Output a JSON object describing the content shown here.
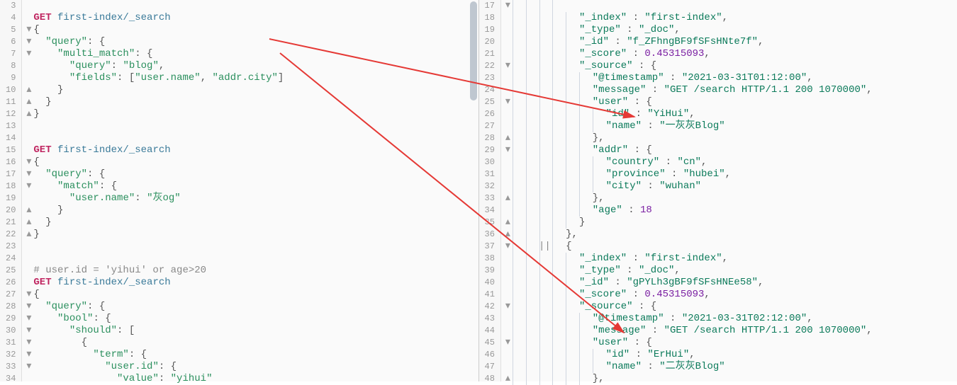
{
  "left": {
    "lines": [
      {
        "n": 3,
        "fold": "",
        "content": [
          {
            "t": " ",
            "c": ""
          }
        ]
      },
      {
        "n": 4,
        "fold": "",
        "content": [
          {
            "t": "GET ",
            "c": "tok-kw"
          },
          {
            "t": "first-index/_search",
            "c": "tok-path"
          }
        ]
      },
      {
        "n": 5,
        "fold": "open",
        "content": [
          {
            "t": "{",
            "c": "tok-punc"
          }
        ]
      },
      {
        "n": 6,
        "fold": "open",
        "content": [
          {
            "t": "  ",
            "c": ""
          },
          {
            "t": "\"query\"",
            "c": "tok-key"
          },
          {
            "t": ": {",
            "c": "tok-punc"
          }
        ]
      },
      {
        "n": 7,
        "fold": "open",
        "content": [
          {
            "t": "    ",
            "c": ""
          },
          {
            "t": "\"multi_match\"",
            "c": "tok-key"
          },
          {
            "t": ": {",
            "c": "tok-punc"
          }
        ]
      },
      {
        "n": 8,
        "fold": "",
        "content": [
          {
            "t": "      ",
            "c": ""
          },
          {
            "t": "\"query\"",
            "c": "tok-key"
          },
          {
            "t": ": ",
            "c": "tok-punc"
          },
          {
            "t": "\"blog\"",
            "c": "tok-str"
          },
          {
            "t": ",",
            "c": "tok-punc"
          }
        ]
      },
      {
        "n": 9,
        "fold": "",
        "content": [
          {
            "t": "      ",
            "c": ""
          },
          {
            "t": "\"fields\"",
            "c": "tok-key"
          },
          {
            "t": ": [",
            "c": "tok-punc"
          },
          {
            "t": "\"user.name\"",
            "c": "tok-str"
          },
          {
            "t": ", ",
            "c": "tok-punc"
          },
          {
            "t": "\"addr.city\"",
            "c": "tok-str"
          },
          {
            "t": "]",
            "c": "tok-punc"
          }
        ]
      },
      {
        "n": 10,
        "fold": "close",
        "content": [
          {
            "t": "    }",
            "c": "tok-punc"
          }
        ]
      },
      {
        "n": 11,
        "fold": "close",
        "content": [
          {
            "t": "  }",
            "c": "tok-punc"
          }
        ]
      },
      {
        "n": 12,
        "fold": "close",
        "content": [
          {
            "t": "}",
            "c": "tok-punc"
          }
        ]
      },
      {
        "n": 13,
        "fold": "",
        "content": [
          {
            "t": " ",
            "c": ""
          }
        ]
      },
      {
        "n": 14,
        "fold": "",
        "content": [
          {
            "t": " ",
            "c": ""
          }
        ]
      },
      {
        "n": 15,
        "fold": "",
        "content": [
          {
            "t": "GET ",
            "c": "tok-kw"
          },
          {
            "t": "first-index/_search",
            "c": "tok-path"
          }
        ]
      },
      {
        "n": 16,
        "fold": "open",
        "content": [
          {
            "t": "{",
            "c": "tok-punc"
          }
        ]
      },
      {
        "n": 17,
        "fold": "open",
        "content": [
          {
            "t": "  ",
            "c": ""
          },
          {
            "t": "\"query\"",
            "c": "tok-key"
          },
          {
            "t": ": {",
            "c": "tok-punc"
          }
        ]
      },
      {
        "n": 18,
        "fold": "open",
        "content": [
          {
            "t": "    ",
            "c": ""
          },
          {
            "t": "\"match\"",
            "c": "tok-key"
          },
          {
            "t": ": {",
            "c": "tok-punc"
          }
        ]
      },
      {
        "n": 19,
        "fold": "",
        "content": [
          {
            "t": "      ",
            "c": ""
          },
          {
            "t": "\"user.name\"",
            "c": "tok-key"
          },
          {
            "t": ": ",
            "c": "tok-punc"
          },
          {
            "t": "\"灰og\"",
            "c": "tok-str"
          }
        ]
      },
      {
        "n": 20,
        "fold": "close",
        "content": [
          {
            "t": "    }",
            "c": "tok-punc"
          }
        ]
      },
      {
        "n": 21,
        "fold": "close",
        "content": [
          {
            "t": "  }",
            "c": "tok-punc"
          }
        ]
      },
      {
        "n": 22,
        "fold": "close",
        "content": [
          {
            "t": "}",
            "c": "tok-punc"
          }
        ]
      },
      {
        "n": 23,
        "fold": "",
        "content": [
          {
            "t": " ",
            "c": ""
          }
        ]
      },
      {
        "n": 24,
        "fold": "",
        "content": [
          {
            "t": " ",
            "c": ""
          }
        ]
      },
      {
        "n": 25,
        "fold": "",
        "content": [
          {
            "t": "# user.id = 'yihui' or age>20",
            "c": "tok-comment"
          }
        ]
      },
      {
        "n": 26,
        "fold": "",
        "content": [
          {
            "t": "GET ",
            "c": "tok-kw"
          },
          {
            "t": "first-index/_search",
            "c": "tok-path"
          }
        ]
      },
      {
        "n": 27,
        "fold": "open",
        "content": [
          {
            "t": "{",
            "c": "tok-punc"
          }
        ]
      },
      {
        "n": 28,
        "fold": "open",
        "content": [
          {
            "t": "  ",
            "c": ""
          },
          {
            "t": "\"query\"",
            "c": "tok-key"
          },
          {
            "t": ": {",
            "c": "tok-punc"
          }
        ]
      },
      {
        "n": 29,
        "fold": "open",
        "content": [
          {
            "t": "    ",
            "c": ""
          },
          {
            "t": "\"bool\"",
            "c": "tok-key"
          },
          {
            "t": ": {",
            "c": "tok-punc"
          }
        ]
      },
      {
        "n": 30,
        "fold": "open",
        "content": [
          {
            "t": "      ",
            "c": ""
          },
          {
            "t": "\"should\"",
            "c": "tok-key"
          },
          {
            "t": ": [",
            "c": "tok-punc"
          }
        ]
      },
      {
        "n": 31,
        "fold": "open",
        "content": [
          {
            "t": "        {",
            "c": "tok-punc"
          }
        ]
      },
      {
        "n": 32,
        "fold": "open",
        "content": [
          {
            "t": "          ",
            "c": ""
          },
          {
            "t": "\"term\"",
            "c": "tok-key"
          },
          {
            "t": ": {",
            "c": "tok-punc"
          }
        ]
      },
      {
        "n": 33,
        "fold": "open",
        "content": [
          {
            "t": "            ",
            "c": ""
          },
          {
            "t": "\"user.id\"",
            "c": "tok-key"
          },
          {
            "t": ": {",
            "c": "tok-punc"
          }
        ]
      },
      {
        "n": 34,
        "fold": "",
        "content": [
          {
            "t": "              ",
            "c": ""
          },
          {
            "t": "\"value\"",
            "c": "tok-key"
          },
          {
            "t": ": ",
            "c": "tok-punc"
          },
          {
            "t": "\"yihui\"",
            "c": "tok-str"
          }
        ]
      }
    ]
  },
  "right": {
    "lines": [
      {
        "n": 17,
        "fold": "open",
        "i": 4,
        "content": [
          {
            "t": " ",
            "c": ""
          }
        ]
      },
      {
        "n": 18,
        "fold": "",
        "i": 5,
        "content": [
          {
            "t": "\"_index\"",
            "c": "tok-key"
          },
          {
            "t": " : ",
            "c": "tok-punc"
          },
          {
            "t": "\"first-index\"",
            "c": "tok-str"
          },
          {
            "t": ",",
            "c": "tok-punc"
          }
        ]
      },
      {
        "n": 19,
        "fold": "",
        "i": 5,
        "content": [
          {
            "t": "\"_type\"",
            "c": "tok-key"
          },
          {
            "t": " : ",
            "c": "tok-punc"
          },
          {
            "t": "\"_doc\"",
            "c": "tok-str"
          },
          {
            "t": ",",
            "c": "tok-punc"
          }
        ]
      },
      {
        "n": 20,
        "fold": "",
        "i": 5,
        "content": [
          {
            "t": "\"_id\"",
            "c": "tok-key"
          },
          {
            "t": " : ",
            "c": "tok-punc"
          },
          {
            "t": "\"f_ZFhngBF9fSFsHNte7f\"",
            "c": "tok-str"
          },
          {
            "t": ",",
            "c": "tok-punc"
          }
        ]
      },
      {
        "n": 21,
        "fold": "",
        "i": 5,
        "content": [
          {
            "t": "\"_score\"",
            "c": "tok-key"
          },
          {
            "t": " : ",
            "c": "tok-punc"
          },
          {
            "t": "0.45315093",
            "c": "tok-num"
          },
          {
            "t": ",",
            "c": "tok-punc"
          }
        ]
      },
      {
        "n": 22,
        "fold": "open",
        "i": 5,
        "content": [
          {
            "t": "\"_source\"",
            "c": "tok-key"
          },
          {
            "t": " : {",
            "c": "tok-punc"
          }
        ]
      },
      {
        "n": 23,
        "fold": "",
        "i": 6,
        "content": [
          {
            "t": "\"@timestamp\"",
            "c": "tok-key"
          },
          {
            "t": " : ",
            "c": "tok-punc"
          },
          {
            "t": "\"2021-03-31T01:12:00\"",
            "c": "tok-str"
          },
          {
            "t": ",",
            "c": "tok-punc"
          }
        ]
      },
      {
        "n": 24,
        "fold": "",
        "i": 6,
        "content": [
          {
            "t": "\"message\"",
            "c": "tok-key"
          },
          {
            "t": " : ",
            "c": "tok-punc"
          },
          {
            "t": "\"GET /search HTTP/1.1 200 1070000\"",
            "c": "tok-str"
          },
          {
            "t": ",",
            "c": "tok-punc"
          }
        ]
      },
      {
        "n": 25,
        "fold": "open",
        "i": 6,
        "content": [
          {
            "t": "\"user\"",
            "c": "tok-key"
          },
          {
            "t": " : {",
            "c": "tok-punc"
          }
        ]
      },
      {
        "n": 26,
        "fold": "",
        "i": 7,
        "content": [
          {
            "t": "\"id\"",
            "c": "tok-key"
          },
          {
            "t": " : ",
            "c": "tok-punc"
          },
          {
            "t": "\"YiHui\"",
            "c": "tok-str"
          },
          {
            "t": ",",
            "c": "tok-punc"
          }
        ]
      },
      {
        "n": 27,
        "fold": "",
        "i": 7,
        "content": [
          {
            "t": "\"name\"",
            "c": "tok-key"
          },
          {
            "t": " : ",
            "c": "tok-punc"
          },
          {
            "t": "\"一灰灰Blog\"",
            "c": "tok-str"
          }
        ]
      },
      {
        "n": 28,
        "fold": "close",
        "i": 6,
        "content": [
          {
            "t": "},",
            "c": "tok-punc"
          }
        ]
      },
      {
        "n": 29,
        "fold": "open",
        "i": 6,
        "content": [
          {
            "t": "\"addr\"",
            "c": "tok-key"
          },
          {
            "t": " : {",
            "c": "tok-punc"
          }
        ]
      },
      {
        "n": 30,
        "fold": "",
        "i": 7,
        "content": [
          {
            "t": "\"country\"",
            "c": "tok-key"
          },
          {
            "t": " : ",
            "c": "tok-punc"
          },
          {
            "t": "\"cn\"",
            "c": "tok-str"
          },
          {
            "t": ",",
            "c": "tok-punc"
          }
        ]
      },
      {
        "n": 31,
        "fold": "",
        "i": 7,
        "content": [
          {
            "t": "\"province\"",
            "c": "tok-key"
          },
          {
            "t": " : ",
            "c": "tok-punc"
          },
          {
            "t": "\"hubei\"",
            "c": "tok-str"
          },
          {
            "t": ",",
            "c": "tok-punc"
          }
        ]
      },
      {
        "n": 32,
        "fold": "",
        "i": 7,
        "content": [
          {
            "t": "\"city\"",
            "c": "tok-key"
          },
          {
            "t": " : ",
            "c": "tok-punc"
          },
          {
            "t": "\"wuhan\"",
            "c": "tok-str"
          }
        ]
      },
      {
        "n": 33,
        "fold": "close",
        "i": 6,
        "content": [
          {
            "t": "},",
            "c": "tok-punc"
          }
        ]
      },
      {
        "n": 34,
        "fold": "",
        "i": 6,
        "content": [
          {
            "t": "\"age\"",
            "c": "tok-key"
          },
          {
            "t": " : ",
            "c": "tok-punc"
          },
          {
            "t": "18",
            "c": "tok-num"
          }
        ]
      },
      {
        "n": 35,
        "fold": "close",
        "i": 5,
        "content": [
          {
            "t": "}",
            "c": "tok-punc"
          }
        ]
      },
      {
        "n": 36,
        "fold": "close",
        "i": 4,
        "content": [
          {
            "t": "},",
            "c": "tok-punc"
          }
        ]
      },
      {
        "n": 37,
        "fold": "open",
        "i": 4,
        "content": [
          {
            "t": "{",
            "c": "tok-punc"
          }
        ]
      },
      {
        "n": 38,
        "fold": "",
        "i": 5,
        "content": [
          {
            "t": "\"_index\"",
            "c": "tok-key"
          },
          {
            "t": " : ",
            "c": "tok-punc"
          },
          {
            "t": "\"first-index\"",
            "c": "tok-str"
          },
          {
            "t": ",",
            "c": "tok-punc"
          }
        ]
      },
      {
        "n": 39,
        "fold": "",
        "i": 5,
        "content": [
          {
            "t": "\"_type\"",
            "c": "tok-key"
          },
          {
            "t": " : ",
            "c": "tok-punc"
          },
          {
            "t": "\"_doc\"",
            "c": "tok-str"
          },
          {
            "t": ",",
            "c": "tok-punc"
          }
        ]
      },
      {
        "n": 40,
        "fold": "",
        "i": 5,
        "content": [
          {
            "t": "\"_id\"",
            "c": "tok-key"
          },
          {
            "t": " : ",
            "c": "tok-punc"
          },
          {
            "t": "\"gPYLh3gBF9fSFsHNEe58\"",
            "c": "tok-str"
          },
          {
            "t": ",",
            "c": "tok-punc"
          }
        ]
      },
      {
        "n": 41,
        "fold": "",
        "i": 5,
        "content": [
          {
            "t": "\"_score\"",
            "c": "tok-key"
          },
          {
            "t": " : ",
            "c": "tok-punc"
          },
          {
            "t": "0.45315093",
            "c": "tok-num"
          },
          {
            "t": ",",
            "c": "tok-punc"
          }
        ]
      },
      {
        "n": 42,
        "fold": "open",
        "i": 5,
        "content": [
          {
            "t": "\"_source\"",
            "c": "tok-key"
          },
          {
            "t": " : {",
            "c": "tok-punc"
          }
        ]
      },
      {
        "n": 43,
        "fold": "",
        "i": 6,
        "content": [
          {
            "t": "\"@timestamp\"",
            "c": "tok-key"
          },
          {
            "t": " : ",
            "c": "tok-punc"
          },
          {
            "t": "\"2021-03-31T02:12:00\"",
            "c": "tok-str"
          },
          {
            "t": ",",
            "c": "tok-punc"
          }
        ]
      },
      {
        "n": 44,
        "fold": "",
        "i": 6,
        "content": [
          {
            "t": "\"message\"",
            "c": "tok-key"
          },
          {
            "t": " : ",
            "c": "tok-punc"
          },
          {
            "t": "\"GET /search HTTP/1.1 200 1070000\"",
            "c": "tok-str"
          },
          {
            "t": ",",
            "c": "tok-punc"
          }
        ]
      },
      {
        "n": 45,
        "fold": "open",
        "i": 6,
        "content": [
          {
            "t": "\"user\"",
            "c": "tok-key"
          },
          {
            "t": " : {",
            "c": "tok-punc"
          }
        ]
      },
      {
        "n": 46,
        "fold": "",
        "i": 7,
        "content": [
          {
            "t": "\"id\"",
            "c": "tok-key"
          },
          {
            "t": " : ",
            "c": "tok-punc"
          },
          {
            "t": "\"ErHui\"",
            "c": "tok-str"
          },
          {
            "t": ",",
            "c": "tok-punc"
          }
        ]
      },
      {
        "n": 47,
        "fold": "",
        "i": 7,
        "content": [
          {
            "t": "\"name\"",
            "c": "tok-key"
          },
          {
            "t": " : ",
            "c": "tok-punc"
          },
          {
            "t": "\"二灰灰Blog\"",
            "c": "tok-str"
          }
        ]
      },
      {
        "n": 48,
        "fold": "close",
        "i": 6,
        "content": [
          {
            "t": "},",
            "c": "tok-punc"
          }
        ]
      }
    ]
  },
  "fold_glyphs": {
    "open": "▾",
    "close": "▴",
    "none": ""
  }
}
